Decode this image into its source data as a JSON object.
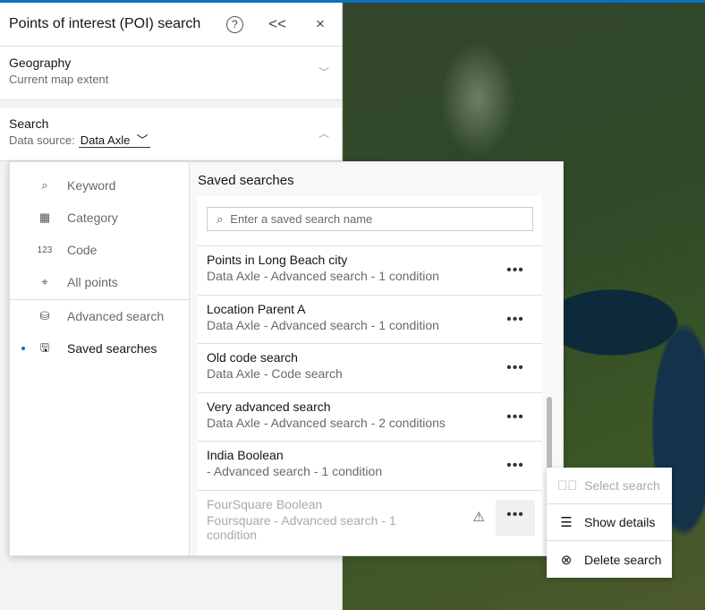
{
  "panel": {
    "title": "Points of interest (POI) search",
    "help": "?",
    "collapse": "<<",
    "close": "×"
  },
  "geography": {
    "title": "Geography",
    "value": "Current map extent"
  },
  "search": {
    "title": "Search",
    "source_label": "Data source:",
    "source_value": "Data Axle"
  },
  "nav": [
    {
      "label": "Keyword",
      "icon": "⌕"
    },
    {
      "label": "Category",
      "icon": "▦"
    },
    {
      "label": "Code",
      "icon": "123"
    },
    {
      "label": "All points",
      "icon": "⌖"
    },
    {
      "label": "Advanced search",
      "icon": "⛁"
    },
    {
      "label": "Saved searches",
      "icon": "💾"
    }
  ],
  "saved": {
    "title": "Saved searches",
    "placeholder": "Enter a saved search name",
    "items": [
      {
        "name": "Points in Long Beach city",
        "detail": "Data Axle - Advanced search - 1 condition"
      },
      {
        "name": "Location Parent A",
        "detail": "Data Axle - Advanced search - 1 condition"
      },
      {
        "name": "Old code search",
        "detail": "Data Axle - Code search"
      },
      {
        "name": "Very advanced search",
        "detail": "Data Axle - Advanced search - 2 conditions"
      },
      {
        "name": "India Boolean",
        "detail": "- Advanced search - 1 condition"
      },
      {
        "name": "FourSquare Boolean",
        "detail": "Foursquare - Advanced search - 1 condition"
      }
    ]
  },
  "menu": {
    "select": "Select search",
    "details": "Show details",
    "delete": "Delete search"
  }
}
